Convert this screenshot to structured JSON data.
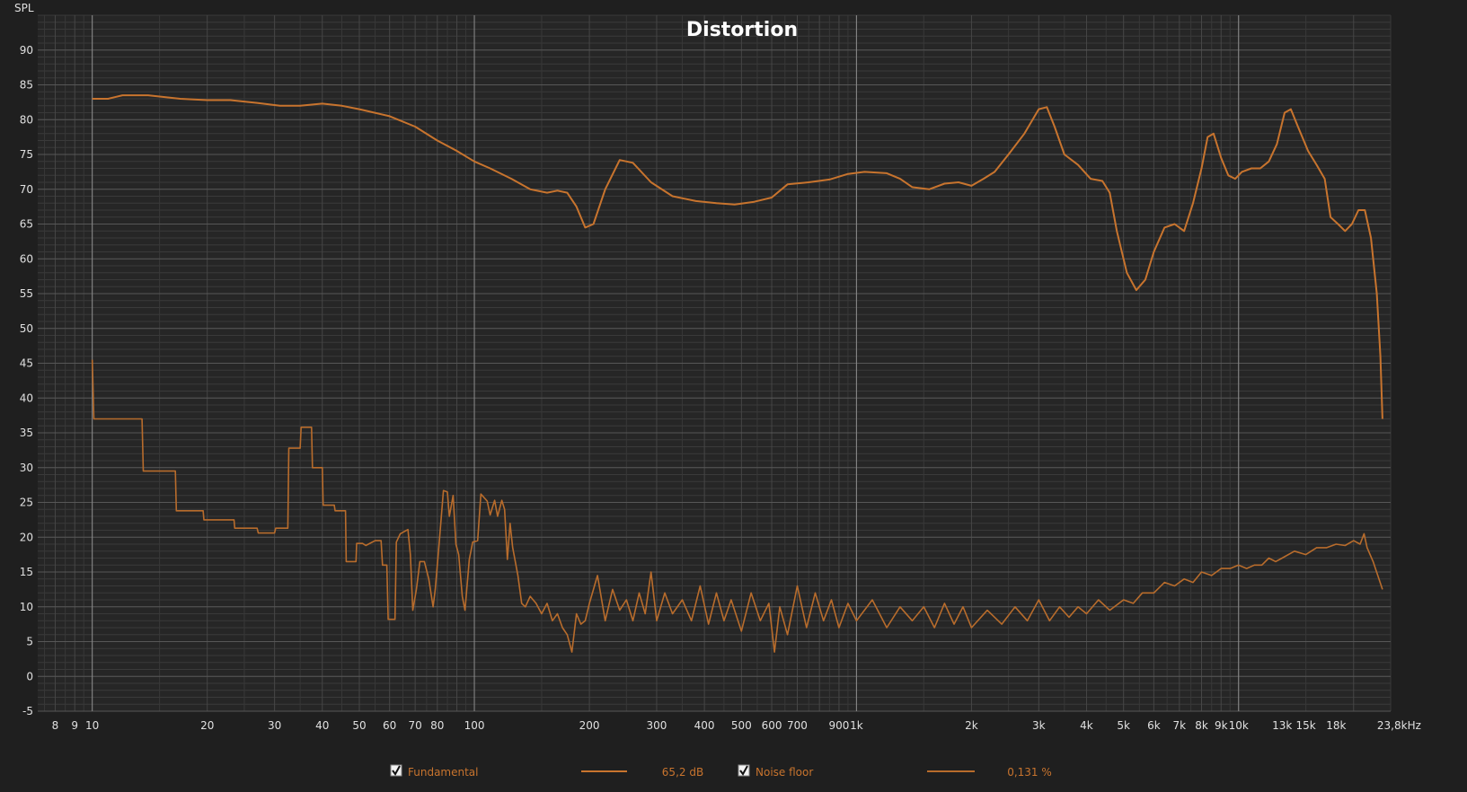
{
  "chart_data": {
    "type": "line",
    "title": "Distortion",
    "ylabel": "SPL",
    "xscale": "log",
    "xlim": [
      7.2,
      25000
    ],
    "ylim": [
      -5,
      95
    ],
    "grid": true,
    "y_ticks": [
      -5,
      0,
      5,
      10,
      15,
      20,
      25,
      30,
      35,
      40,
      45,
      50,
      55,
      60,
      65,
      70,
      75,
      80,
      85,
      90
    ],
    "x_ticks": [
      {
        "v": 8,
        "label": "8"
      },
      {
        "v": 9,
        "label": "9"
      },
      {
        "v": 10,
        "label": "10"
      },
      {
        "v": 20,
        "label": "20"
      },
      {
        "v": 30,
        "label": "30"
      },
      {
        "v": 40,
        "label": "40"
      },
      {
        "v": 50,
        "label": "50"
      },
      {
        "v": 60,
        "label": "60"
      },
      {
        "v": 70,
        "label": "70"
      },
      {
        "v": 80,
        "label": "80"
      },
      {
        "v": 100,
        "label": "100"
      },
      {
        "v": 200,
        "label": "200"
      },
      {
        "v": 300,
        "label": "300"
      },
      {
        "v": 400,
        "label": "400"
      },
      {
        "v": 500,
        "label": "500"
      },
      {
        "v": 600,
        "label": "600"
      },
      {
        "v": 700,
        "label": "700"
      },
      {
        "v": 900,
        "label": "900"
      },
      {
        "v": 1000,
        "label": "1k"
      },
      {
        "v": 2000,
        "label": "2k"
      },
      {
        "v": 3000,
        "label": "3k"
      },
      {
        "v": 4000,
        "label": "4k"
      },
      {
        "v": 5000,
        "label": "5k"
      },
      {
        "v": 6000,
        "label": "6k"
      },
      {
        "v": 7000,
        "label": "7k"
      },
      {
        "v": 8000,
        "label": "8k"
      },
      {
        "v": 9000,
        "label": "9k"
      },
      {
        "v": 10000,
        "label": "10k"
      },
      {
        "v": 13000,
        "label": "13k"
      },
      {
        "v": 15000,
        "label": "15k"
      },
      {
        "v": 18000,
        "label": "18k"
      },
      {
        "v": 23800,
        "label": "23,8kHz"
      }
    ],
    "series": [
      {
        "name": "Fundamental",
        "color": "#c8742e",
        "legend_value": "65,2 dB",
        "checked": true,
        "points": [
          [
            10,
            83
          ],
          [
            11,
            83
          ],
          [
            12,
            83.5
          ],
          [
            14,
            83.5
          ],
          [
            17,
            83
          ],
          [
            20,
            82.8
          ],
          [
            23,
            82.8
          ],
          [
            27,
            82.4
          ],
          [
            31,
            82
          ],
          [
            35,
            82
          ],
          [
            40,
            82.3
          ],
          [
            45,
            82
          ],
          [
            50,
            81.5
          ],
          [
            60,
            80.5
          ],
          [
            70,
            79
          ],
          [
            80,
            77
          ],
          [
            90,
            75.5
          ],
          [
            100,
            74
          ],
          [
            110,
            73
          ],
          [
            125,
            71.5
          ],
          [
            140,
            70
          ],
          [
            155,
            69.5
          ],
          [
            165,
            69.8
          ],
          [
            175,
            69.5
          ],
          [
            185,
            67.5
          ],
          [
            195,
            64.5
          ],
          [
            205,
            65
          ],
          [
            220,
            70
          ],
          [
            240,
            74.2
          ],
          [
            260,
            73.8
          ],
          [
            290,
            71
          ],
          [
            330,
            69
          ],
          [
            380,
            68.3
          ],
          [
            430,
            68
          ],
          [
            480,
            67.8
          ],
          [
            540,
            68.2
          ],
          [
            600,
            68.8
          ],
          [
            660,
            70.7
          ],
          [
            750,
            71
          ],
          [
            850,
            71.4
          ],
          [
            950,
            72.2
          ],
          [
            1050,
            72.5
          ],
          [
            1200,
            72.3
          ],
          [
            1300,
            71.5
          ],
          [
            1400,
            70.3
          ],
          [
            1550,
            70
          ],
          [
            1700,
            70.8
          ],
          [
            1850,
            71
          ],
          [
            2000,
            70.5
          ],
          [
            2150,
            71.5
          ],
          [
            2300,
            72.5
          ],
          [
            2500,
            75
          ],
          [
            2750,
            78
          ],
          [
            3000,
            81.5
          ],
          [
            3150,
            81.8
          ],
          [
            3300,
            79
          ],
          [
            3500,
            75
          ],
          [
            3800,
            73.5
          ],
          [
            4100,
            71.5
          ],
          [
            4400,
            71.2
          ],
          [
            4600,
            69.5
          ],
          [
            4800,
            64
          ],
          [
            5100,
            58
          ],
          [
            5400,
            55.5
          ],
          [
            5700,
            57
          ],
          [
            6000,
            61
          ],
          [
            6400,
            64.5
          ],
          [
            6800,
            65
          ],
          [
            7200,
            64
          ],
          [
            7600,
            68
          ],
          [
            8000,
            73
          ],
          [
            8300,
            77.5
          ],
          [
            8600,
            78
          ],
          [
            9000,
            74.5
          ],
          [
            9400,
            72
          ],
          [
            9800,
            71.5
          ],
          [
            10200,
            72.5
          ],
          [
            10800,
            73
          ],
          [
            11400,
            73
          ],
          [
            12000,
            74
          ],
          [
            12600,
            76.5
          ],
          [
            13200,
            81
          ],
          [
            13700,
            81.5
          ],
          [
            14300,
            79
          ],
          [
            15200,
            75.5
          ],
          [
            16000,
            73.5
          ],
          [
            16800,
            71.5
          ],
          [
            17400,
            66
          ],
          [
            18200,
            65
          ],
          [
            19000,
            64
          ],
          [
            19800,
            65
          ],
          [
            20600,
            67
          ],
          [
            21400,
            67
          ],
          [
            22200,
            63
          ],
          [
            23000,
            55
          ],
          [
            23500,
            46
          ],
          [
            23800,
            37
          ]
        ]
      },
      {
        "name": "Noise floor",
        "color": "#b86c2c",
        "legend_value": "0,131 %",
        "checked": true,
        "points": [
          [
            10,
            45.5
          ],
          [
            10.1,
            37
          ],
          [
            13.5,
            37
          ],
          [
            13.6,
            29.5
          ],
          [
            16.5,
            29.5
          ],
          [
            16.6,
            23.8
          ],
          [
            19.5,
            23.8
          ],
          [
            19.6,
            22.5
          ],
          [
            23.5,
            22.5
          ],
          [
            23.6,
            21.3
          ],
          [
            27,
            21.3
          ],
          [
            27.2,
            20.6
          ],
          [
            30,
            20.6
          ],
          [
            30.2,
            21.3
          ],
          [
            32.5,
            21.3
          ],
          [
            32.7,
            32.8
          ],
          [
            35,
            32.8
          ],
          [
            35.2,
            35.8
          ],
          [
            37.5,
            35.8
          ],
          [
            37.7,
            30
          ],
          [
            40,
            30
          ],
          [
            40.2,
            24.6
          ],
          [
            43,
            24.6
          ],
          [
            43.2,
            23.8
          ],
          [
            46,
            23.8
          ],
          [
            46.2,
            16.5
          ],
          [
            49,
            16.5
          ],
          [
            49.2,
            19.1
          ],
          [
            51,
            19.1
          ],
          [
            52,
            18.8
          ],
          [
            55,
            19.5
          ],
          [
            57,
            19.5
          ],
          [
            57.5,
            16
          ],
          [
            59,
            16
          ],
          [
            59.5,
            8.2
          ],
          [
            62,
            8.2
          ],
          [
            62.5,
            19.3
          ],
          [
            64,
            20.5
          ],
          [
            67,
            21.1
          ],
          [
            68,
            17.5
          ],
          [
            69,
            9.5
          ],
          [
            70.5,
            12.5
          ],
          [
            72,
            16.5
          ],
          [
            74,
            16.5
          ],
          [
            76,
            14
          ],
          [
            78,
            10
          ],
          [
            79,
            12.5
          ],
          [
            81,
            19.5
          ],
          [
            83,
            26.7
          ],
          [
            85,
            26.5
          ],
          [
            86,
            23
          ],
          [
            88,
            26
          ],
          [
            89.5,
            19
          ],
          [
            91,
            17.5
          ],
          [
            93,
            11.5
          ],
          [
            94.5,
            9.5
          ],
          [
            97,
            16.8
          ],
          [
            99,
            19.3
          ],
          [
            102,
            19.5
          ],
          [
            104,
            26.2
          ],
          [
            108,
            25.2
          ],
          [
            110,
            23.2
          ],
          [
            113,
            25.3
          ],
          [
            115,
            23
          ],
          [
            118,
            25.3
          ],
          [
            120,
            24
          ],
          [
            122,
            16.8
          ],
          [
            124,
            22
          ],
          [
            126,
            18.5
          ],
          [
            128,
            16.5
          ],
          [
            130,
            14.5
          ],
          [
            133,
            10.5
          ],
          [
            136,
            10
          ],
          [
            140,
            11.5
          ],
          [
            145,
            10.5
          ],
          [
            150,
            9
          ],
          [
            155,
            10.5
          ],
          [
            160,
            8
          ],
          [
            165,
            9
          ],
          [
            170,
            7
          ],
          [
            175,
            6
          ],
          [
            180,
            3.5
          ],
          [
            185,
            9
          ],
          [
            190,
            7.5
          ],
          [
            195,
            8
          ],
          [
            200,
            10.5
          ],
          [
            210,
            14.5
          ],
          [
            220,
            8
          ],
          [
            230,
            12.5
          ],
          [
            240,
            9.5
          ],
          [
            250,
            11
          ],
          [
            260,
            8
          ],
          [
            270,
            12
          ],
          [
            280,
            9
          ],
          [
            290,
            15
          ],
          [
            300,
            8
          ],
          [
            315,
            12
          ],
          [
            330,
            9
          ],
          [
            350,
            11
          ],
          [
            370,
            8
          ],
          [
            390,
            13
          ],
          [
            410,
            7.5
          ],
          [
            430,
            12
          ],
          [
            450,
            8
          ],
          [
            470,
            11
          ],
          [
            500,
            6.5
          ],
          [
            530,
            12
          ],
          [
            560,
            8
          ],
          [
            590,
            10.5
          ],
          [
            610,
            3.5
          ],
          [
            630,
            10
          ],
          [
            660,
            6
          ],
          [
            700,
            13
          ],
          [
            740,
            7
          ],
          [
            780,
            12
          ],
          [
            820,
            8
          ],
          [
            860,
            11
          ],
          [
            900,
            7
          ],
          [
            950,
            10.5
          ],
          [
            1000,
            8
          ],
          [
            1100,
            11
          ],
          [
            1200,
            7
          ],
          [
            1300,
            10
          ],
          [
            1400,
            8
          ],
          [
            1500,
            10
          ],
          [
            1600,
            7
          ],
          [
            1700,
            10.5
          ],
          [
            1800,
            7.5
          ],
          [
            1900,
            10
          ],
          [
            2000,
            7
          ],
          [
            2200,
            9.5
          ],
          [
            2400,
            7.5
          ],
          [
            2600,
            10
          ],
          [
            2800,
            8
          ],
          [
            3000,
            11
          ],
          [
            3200,
            8
          ],
          [
            3400,
            10
          ],
          [
            3600,
            8.5
          ],
          [
            3800,
            10
          ],
          [
            4000,
            9
          ],
          [
            4300,
            11
          ],
          [
            4600,
            9.5
          ],
          [
            5000,
            11
          ],
          [
            5300,
            10.5
          ],
          [
            5600,
            12
          ],
          [
            6000,
            12
          ],
          [
            6400,
            13.5
          ],
          [
            6800,
            13
          ],
          [
            7200,
            14
          ],
          [
            7600,
            13.5
          ],
          [
            8000,
            15
          ],
          [
            8500,
            14.5
          ],
          [
            9000,
            15.5
          ],
          [
            9500,
            15.5
          ],
          [
            10000,
            16
          ],
          [
            10500,
            15.5
          ],
          [
            11000,
            16
          ],
          [
            11500,
            16
          ],
          [
            12000,
            17
          ],
          [
            12500,
            16.5
          ],
          [
            13000,
            17
          ],
          [
            14000,
            18
          ],
          [
            15000,
            17.5
          ],
          [
            16000,
            18.5
          ],
          [
            17000,
            18.5
          ],
          [
            18000,
            19
          ],
          [
            19000,
            18.8
          ],
          [
            20000,
            19.5
          ],
          [
            20800,
            19
          ],
          [
            21300,
            20.5
          ],
          [
            21700,
            18.5
          ],
          [
            22500,
            16.5
          ],
          [
            23300,
            14
          ],
          [
            23800,
            12.5
          ]
        ]
      }
    ]
  }
}
